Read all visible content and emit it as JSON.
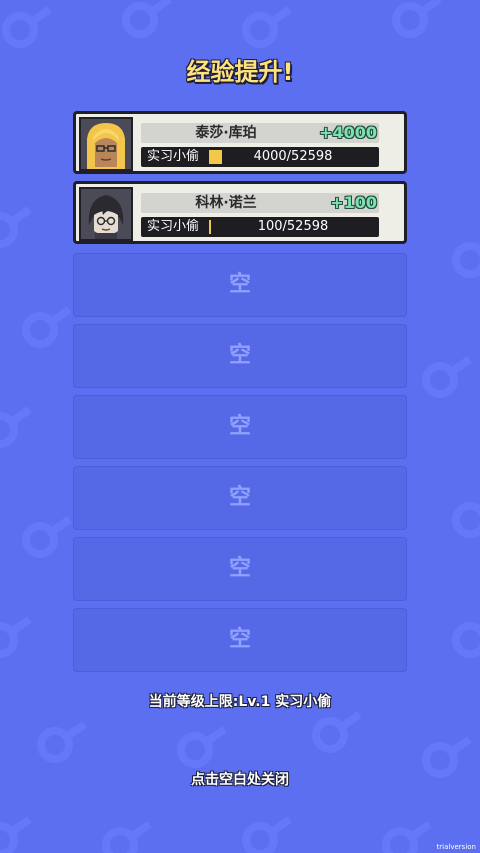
{
  "title": "经验提升!",
  "characters": [
    {
      "name": "泰莎·库珀",
      "gain": "+4000",
      "level_name": "实习小偷",
      "xp": "4000/52598",
      "progress": 0.076
    },
    {
      "name": "科林·诺兰",
      "gain": "+100",
      "level_name": "实习小偷",
      "xp": "100/52598",
      "progress": 0.002
    }
  ],
  "empty_slot_label": "空",
  "level_cap": "当前等级上限:Lv.1 实习小偷",
  "close_hint": "点击空白处关闭",
  "watermark": "trialversion",
  "colors": {
    "background": "#5b6ff0",
    "title": "#ffe27a",
    "gain": "#7fe0b4",
    "progress": "#f2c84b"
  }
}
